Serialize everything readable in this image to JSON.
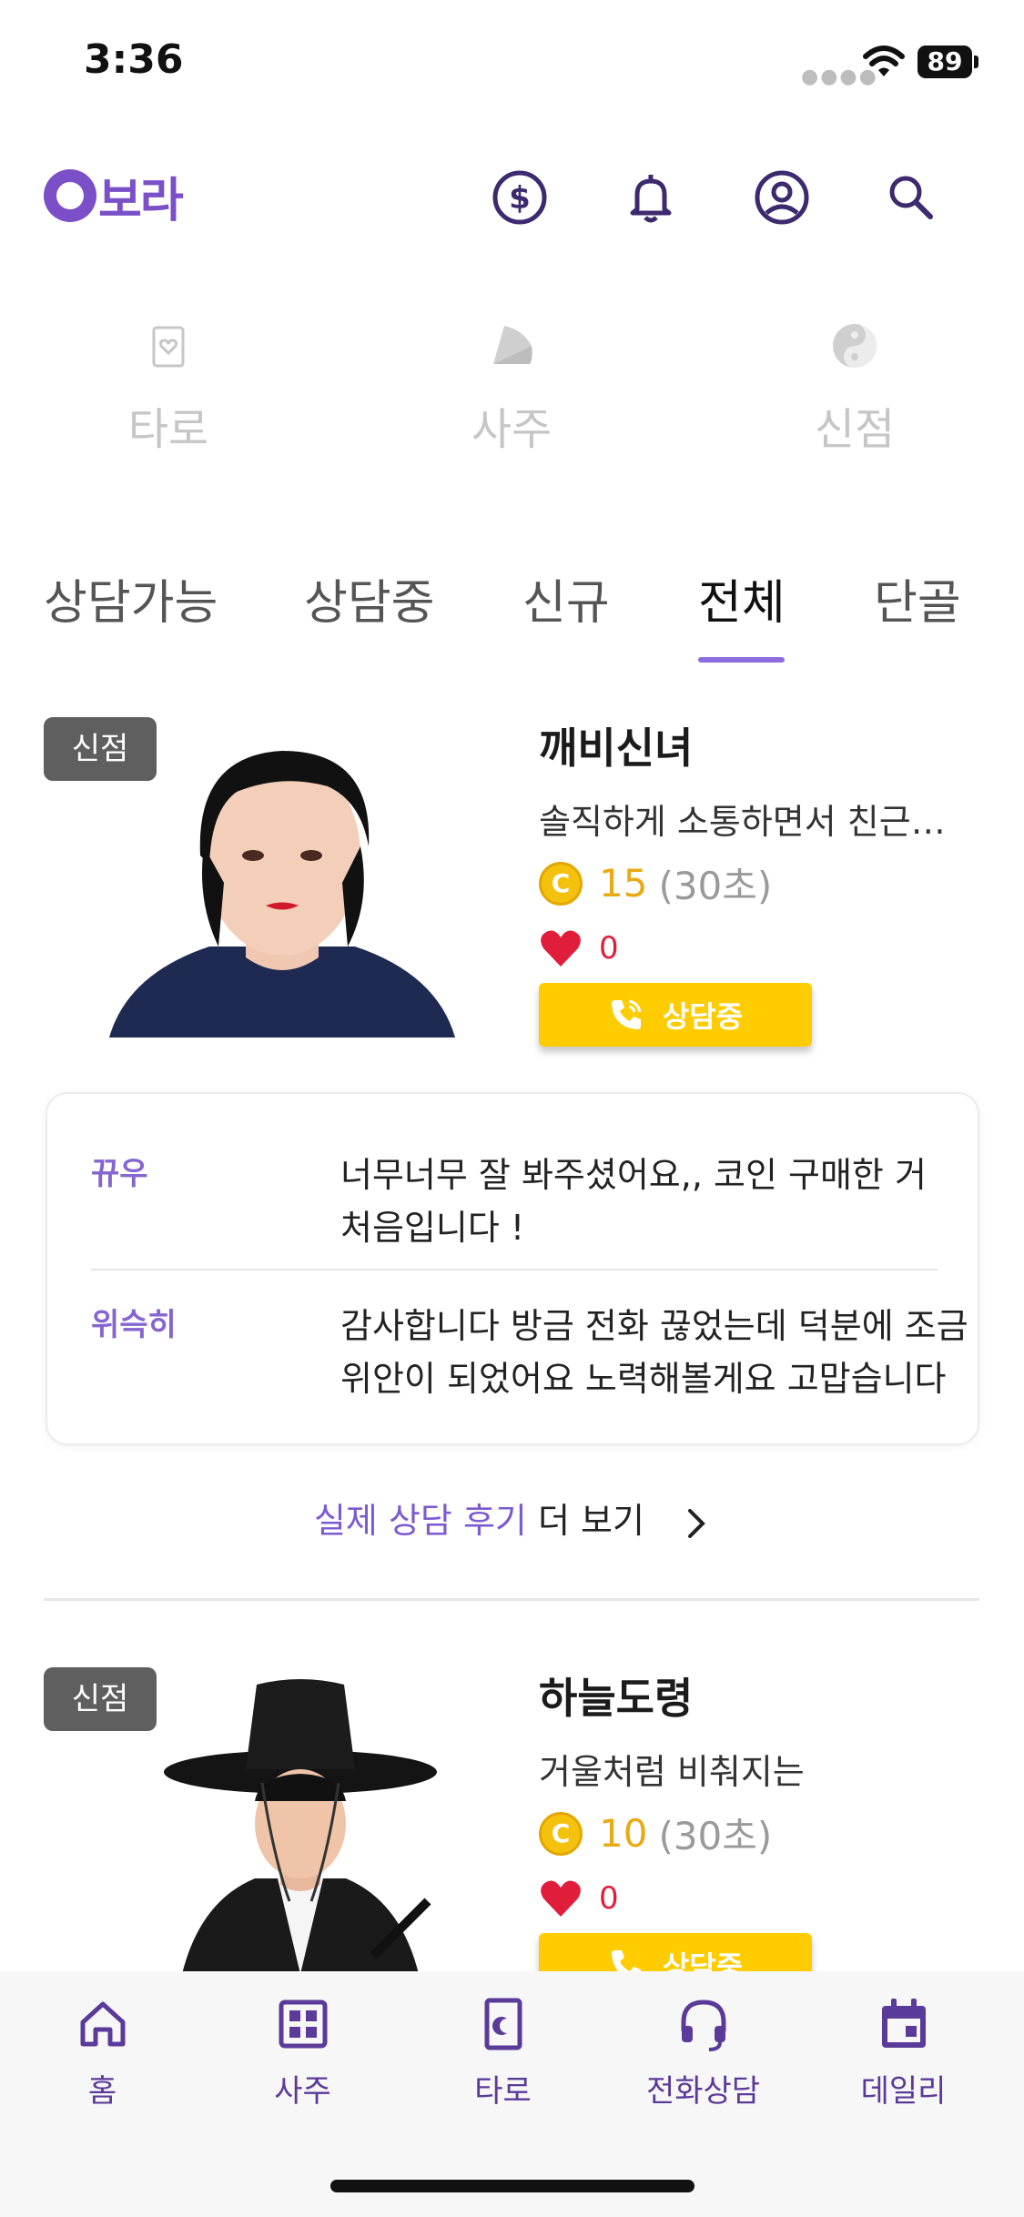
{
  "status_bar": {
    "time": "3:36",
    "battery": "89"
  },
  "header": {
    "logo_text": "보라",
    "icons": [
      "coin-icon",
      "bell-icon",
      "profile-icon",
      "search-icon"
    ]
  },
  "categories": [
    {
      "label": "타로",
      "icon": "tarot-card-icon"
    },
    {
      "label": "사주",
      "icon": "fan-icon"
    },
    {
      "label": "신점",
      "icon": "yin-yang-icon"
    }
  ],
  "tabs": [
    {
      "label": "상담가능",
      "active": false
    },
    {
      "label": "상담중",
      "active": false
    },
    {
      "label": "신규",
      "active": false
    },
    {
      "label": "전체",
      "active": true
    },
    {
      "label": "단골",
      "active": false
    }
  ],
  "counselors": [
    {
      "badge": "신점",
      "name": "깨비신녀",
      "description": "솔직하게 소통하면서 친근하게 상담해드립니다",
      "price": "15",
      "price_unit": "(30초)",
      "likes": "0",
      "call_label": "상담중"
    },
    {
      "badge": "신점",
      "name": "하늘도령",
      "description": "거울처럼 비춰지는",
      "price": "10",
      "price_unit": "(30초)",
      "likes": "0",
      "call_label": "상담중"
    }
  ],
  "reviews": [
    {
      "user": "뀨우",
      "text": "너무너무 잘 봐주셨어요,, 코인 구매한 거 처음입니다 !"
    },
    {
      "user": "위슥히",
      "text": "감사합니다 방금 전화 끊었는데 덕분에 조금 위안이 되었어요 노력해볼게요 고맙습니다"
    }
  ],
  "more_reviews": {
    "accent": "실제 상담 후기",
    "rest": "더 보기"
  },
  "bottom_nav": [
    {
      "label": "홈",
      "icon": "home-icon"
    },
    {
      "label": "사주",
      "icon": "grid-icon"
    },
    {
      "label": "타로",
      "icon": "moon-card-icon"
    },
    {
      "label": "전화상담",
      "icon": "headset-icon"
    },
    {
      "label": "데일리",
      "icon": "calendar-icon"
    }
  ],
  "colors": {
    "brand": "#7a4fc8",
    "accent": "#8d6ce0",
    "call_button": "#ffcc00",
    "price": "#e9aa13",
    "heart": "#e01e3c"
  }
}
